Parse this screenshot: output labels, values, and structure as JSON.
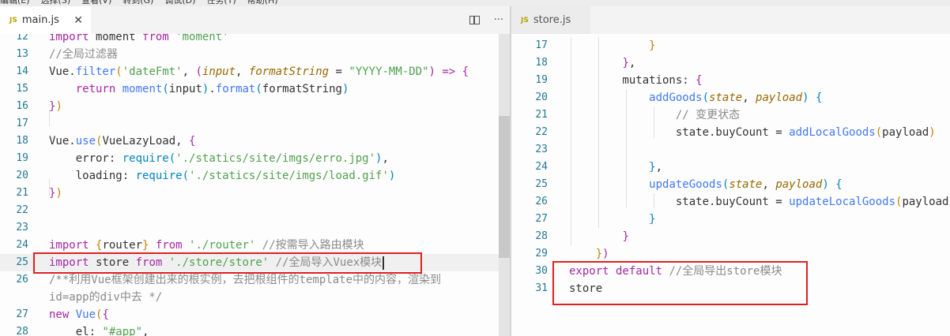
{
  "menu": [
    "编辑(E)",
    "选择(S)",
    "查看(V)",
    "转到(G)",
    "调试(D)",
    "任务(T)",
    "帮助(H)"
  ],
  "left_tab": {
    "icon": "JS",
    "label": "main.js",
    "close": "✕"
  },
  "right_tab": {
    "icon": "JS",
    "label": "store.js"
  },
  "actions": {
    "more": "···"
  },
  "left_lines": [
    {
      "no": "12",
      "parts": [
        [
          "k",
          "import"
        ],
        [
          "n",
          " moment "
        ],
        [
          "k",
          "from"
        ],
        [
          "s",
          " 'moment'"
        ]
      ]
    },
    {
      "no": "13",
      "parts": [
        [
          "c",
          "//全局过滤器"
        ]
      ]
    },
    {
      "no": "14",
      "parts": [
        [
          "n",
          "Vue."
        ],
        [
          "f",
          "filter"
        ],
        [
          "b",
          "("
        ],
        [
          "s",
          "'dateFmt'"
        ],
        [
          "n",
          ", "
        ],
        [
          "b2",
          "("
        ],
        [
          "p",
          "input"
        ],
        [
          "n",
          ", "
        ],
        [
          "p",
          "formatString"
        ],
        [
          "n",
          " = "
        ],
        [
          "s",
          "\"YYYY-MM-DD\""
        ],
        [
          "b2",
          ")"
        ],
        [
          "k",
          " => "
        ],
        [
          "b2",
          "{"
        ]
      ]
    },
    {
      "no": "15",
      "parts": [
        [
          "n",
          "    "
        ],
        [
          "k",
          "return"
        ],
        [
          "f",
          " moment"
        ],
        [
          "b3",
          "("
        ],
        [
          "n",
          "input"
        ],
        [
          "b3",
          ")"
        ],
        [
          "n",
          "."
        ],
        [
          "f",
          "format"
        ],
        [
          "b3",
          "("
        ],
        [
          "n",
          "formatString"
        ],
        [
          "b3",
          ")"
        ]
      ]
    },
    {
      "no": "16",
      "parts": [
        [
          "b2",
          "}"
        ],
        [
          "b",
          ")"
        ]
      ]
    },
    {
      "no": "17",
      "parts": []
    },
    {
      "no": "18",
      "parts": [
        [
          "n",
          "Vue."
        ],
        [
          "f",
          "use"
        ],
        [
          "b",
          "("
        ],
        [
          "n",
          "VueLazyLoad, "
        ],
        [
          "b2",
          "{"
        ]
      ]
    },
    {
      "no": "19",
      "parts": [
        [
          "n",
          "    error: "
        ],
        [
          "fn",
          "require"
        ],
        [
          "b3",
          "("
        ],
        [
          "s",
          "'./statics/site/imgs/erro.jpg'"
        ],
        [
          "b3",
          ")"
        ],
        [
          "n",
          ","
        ]
      ]
    },
    {
      "no": "20",
      "parts": [
        [
          "n",
          "    loading: "
        ],
        [
          "fn",
          "require"
        ],
        [
          "b3",
          "("
        ],
        [
          "s",
          "'./statics/site/imgs/load.gif'"
        ],
        [
          "b3",
          ")"
        ]
      ]
    },
    {
      "no": "21",
      "parts": [
        [
          "b2",
          "}"
        ],
        [
          "b",
          ")"
        ]
      ]
    },
    {
      "no": "22",
      "parts": []
    },
    {
      "no": "23",
      "parts": []
    },
    {
      "no": "24",
      "parts": [
        [
          "k",
          "import"
        ],
        [
          "n",
          " "
        ],
        [
          "b",
          "{"
        ],
        [
          "n",
          "router"
        ],
        [
          "b",
          "}"
        ],
        [
          "k",
          " from"
        ],
        [
          "s",
          " './router'"
        ],
        [
          "c",
          " //按需导入路由模块"
        ]
      ]
    },
    {
      "no": "25",
      "parts": [
        [
          "k",
          "import"
        ],
        [
          "n",
          " store "
        ],
        [
          "k",
          "from"
        ],
        [
          "s",
          " './store/store'"
        ],
        [
          "c",
          " //全局导入Vuex模块"
        ]
      ]
    },
    {
      "no": "26",
      "parts": [
        [
          "c",
          "/**利用Vue框架创建出来的根实例，去把根组件的template中的内容，渲染到"
        ]
      ]
    },
    {
      "no": "",
      "parts": [
        [
          "c",
          "id=app的div中去 */"
        ]
      ]
    },
    {
      "no": "27",
      "parts": [
        [
          "k",
          "new"
        ],
        [
          "f",
          " Vue"
        ],
        [
          "b",
          "("
        ],
        [
          "b2",
          "{"
        ]
      ]
    },
    {
      "no": "28",
      "parts": [
        [
          "n",
          "    el: "
        ],
        [
          "s",
          "\"#app\""
        ],
        [
          "n",
          ","
        ]
      ]
    }
  ],
  "right_lines": [
    {
      "no": "17",
      "parts": [
        [
          "n",
          "            "
        ],
        [
          "b",
          "}"
        ]
      ]
    },
    {
      "no": "18",
      "parts": [
        [
          "n",
          "        "
        ],
        [
          "b2",
          "}"
        ],
        [
          "n",
          ","
        ]
      ]
    },
    {
      "no": "19",
      "parts": [
        [
          "n",
          "        mutations: "
        ],
        [
          "b2",
          "{"
        ]
      ]
    },
    {
      "no": "20",
      "parts": [
        [
          "n",
          "            "
        ],
        [
          "f",
          "addGoods"
        ],
        [
          "b3",
          "("
        ],
        [
          "p",
          "state"
        ],
        [
          "n",
          ", "
        ],
        [
          "p",
          "payload"
        ],
        [
          "b3",
          ")"
        ],
        [
          "n",
          " "
        ],
        [
          "b3",
          "{"
        ]
      ]
    },
    {
      "no": "21",
      "parts": [
        [
          "n",
          "                "
        ],
        [
          "c",
          "// 变更状态"
        ]
      ]
    },
    {
      "no": "22",
      "parts": [
        [
          "n",
          "                state.buyCount = "
        ],
        [
          "f",
          "addLocalGoods"
        ],
        [
          "b",
          "("
        ],
        [
          "n",
          "payload"
        ],
        [
          "b",
          ")"
        ]
      ]
    },
    {
      "no": "23",
      "parts": []
    },
    {
      "no": "24",
      "parts": [
        [
          "n",
          "            "
        ],
        [
          "b3",
          "}"
        ],
        [
          "n",
          ","
        ]
      ]
    },
    {
      "no": "25",
      "parts": [
        [
          "n",
          "            "
        ],
        [
          "f",
          "updateGoods"
        ],
        [
          "b3",
          "("
        ],
        [
          "p",
          "state"
        ],
        [
          "n",
          ", "
        ],
        [
          "p",
          "payload"
        ],
        [
          "b3",
          ")"
        ],
        [
          "n",
          " "
        ],
        [
          "b3",
          "{"
        ]
      ]
    },
    {
      "no": "26",
      "parts": [
        [
          "n",
          "                state.buyCount = "
        ],
        [
          "f",
          "updateLocalGoods"
        ],
        [
          "b",
          "("
        ],
        [
          "n",
          "payload"
        ],
        [
          "b",
          ")"
        ]
      ]
    },
    {
      "no": "27",
      "parts": [
        [
          "n",
          "            "
        ],
        [
          "b3",
          "}"
        ]
      ]
    },
    {
      "no": "28",
      "parts": [
        [
          "n",
          "        "
        ],
        [
          "b2",
          "}"
        ]
      ]
    },
    {
      "no": "29",
      "parts": [
        [
          "n",
          "    "
        ],
        [
          "b",
          "}"
        ],
        [
          "b2",
          ")"
        ]
      ]
    },
    {
      "no": "30",
      "parts": [
        [
          "k",
          "export"
        ],
        [
          "k",
          " default"
        ],
        [
          "c",
          " //全局导出store模块"
        ]
      ]
    },
    {
      "no": "31",
      "parts": [
        [
          "n",
          "store"
        ]
      ]
    }
  ],
  "colors": {
    "highlight": "#e02020",
    "keyword": "#a626a4",
    "string": "#50a14f",
    "comment": "#8a8a8a",
    "function": "#4078f2"
  }
}
